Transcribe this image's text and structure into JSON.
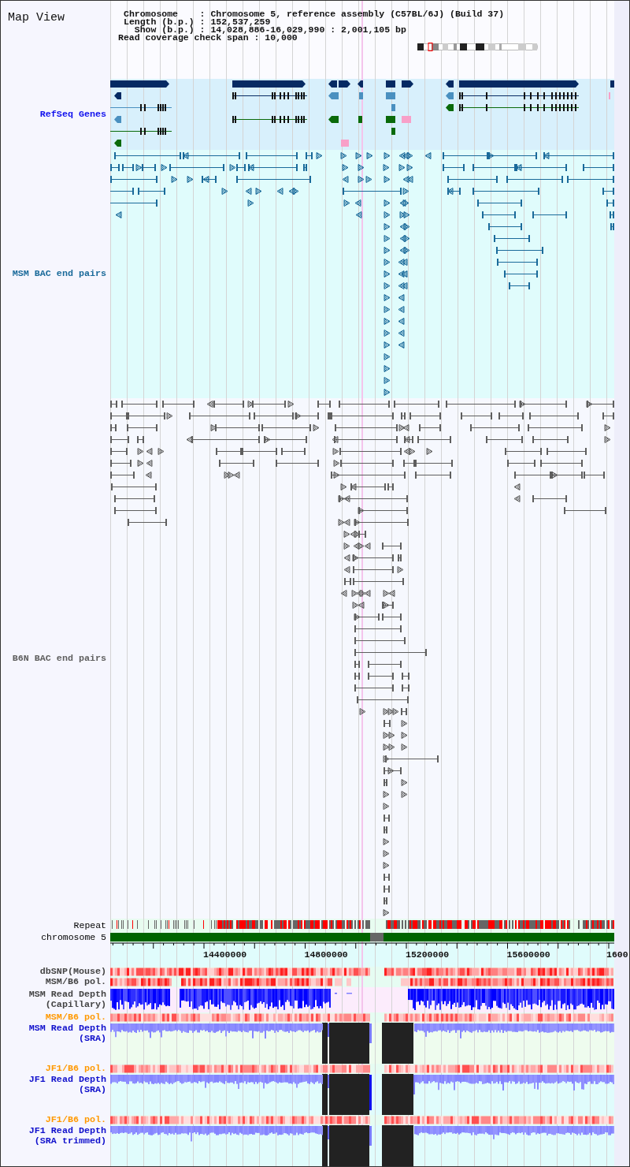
{
  "title": "Map View",
  "info": [
    {
      "label": "Chromosome",
      "separator": ":",
      "value": "Chromosome 5, reference assembly (C57BL/6J) (Build 37)"
    },
    {
      "label": "Length (b.p.)",
      "separator": ":",
      "value": "152,537,259"
    },
    {
      "label": "Show (b.p.)",
      "separator": ":",
      "value": "14,028,886-16,029,990 : 2,001,105 bp"
    },
    {
      "label": "Read coverage check span",
      "separator": ":",
      "value": "10,000"
    }
  ],
  "tracks": [
    {
      "kind": "genes",
      "label": "RefSeq Genes",
      "color": "#1010ee"
    },
    {
      "kind": "bac_pairs",
      "label": "MSM BAC end pairs",
      "color": "#1a6a9a"
    },
    {
      "kind": "bac_pairs",
      "label": "B6N BAC end pairs",
      "color": "#5e5e5e"
    },
    {
      "kind": "repeat",
      "label": "Repeat",
      "color": "#000000"
    },
    {
      "kind": "chromosome",
      "label": "chromosome 5",
      "color": "#000000"
    }
  ],
  "axis": {
    "labels": [
      "14400000",
      "14800000",
      "15200000",
      "15600000",
      "1600"
    ]
  },
  "data_tracks": [
    {
      "kind": "heatmap",
      "label": "dbSNP(Mouse)",
      "color": "#444444"
    },
    {
      "kind": "heatmap",
      "label": "MSM/B6 pol.",
      "color": "#444444"
    },
    {
      "kind": "capillary_depth",
      "label": "MSM Read Depth",
      "sublabel": "(Capillary)",
      "color": "#444444"
    },
    {
      "kind": "heatmap",
      "label": "MSM/B6 pol.",
      "color": "#ff9900"
    },
    {
      "kind": "sra_depth",
      "label": "MSM Read Depth",
      "sublabel": "(SRA)",
      "color": "#1010cc"
    },
    {
      "kind": "heatmap",
      "label": "JF1/B6 pol.",
      "color": "#ff9900"
    },
    {
      "kind": "sra_depth",
      "label": "JF1 Read Depth",
      "sublabel": "(SRA)",
      "color": "#1010cc"
    },
    {
      "kind": "heatmap",
      "label": "JF1/B6 pol.",
      "color": "#ff9900"
    },
    {
      "kind": "sra_depth",
      "label": "JF1 Read Depth",
      "sublabel": "(SRA trimmed)",
      "color": "#1010cc"
    }
  ]
}
